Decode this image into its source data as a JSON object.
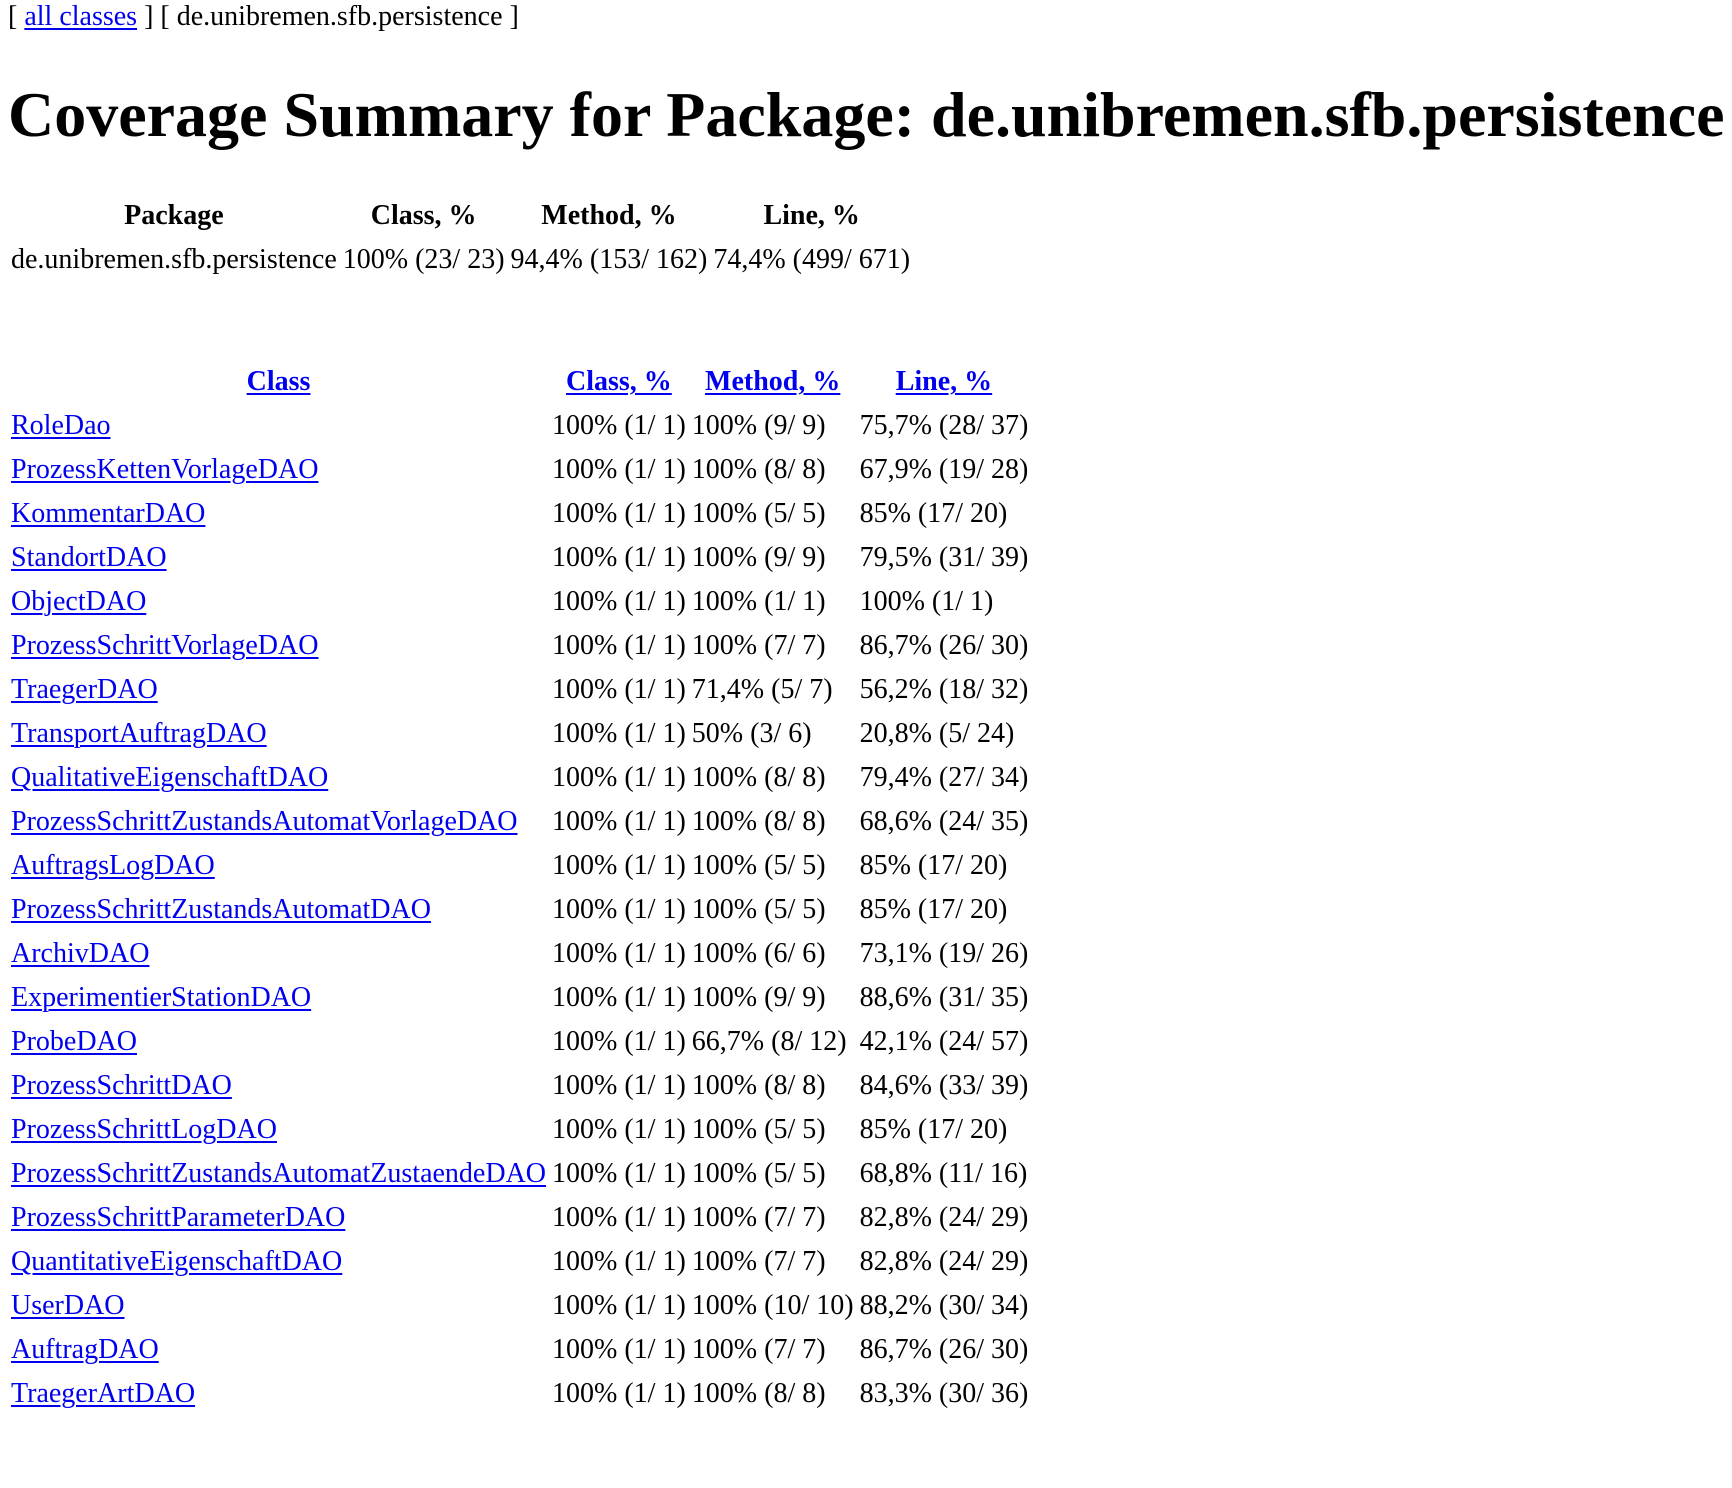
{
  "breadcrumb": {
    "open1": "[ ",
    "link": "all classes",
    "mid": " ] [ ",
    "current": "de.unibremen.sfb.persistence",
    "close": " ]"
  },
  "title": "Coverage Summary for Package: de.unibremen.sfb.persistence",
  "package_summary": {
    "headers": [
      "Package",
      "Class, %",
      "Method, %",
      "Line, %"
    ],
    "row": {
      "name": "de.unibremen.sfb.persistence",
      "class": "100% (23/ 23)",
      "method": "94,4% (153/ 162)",
      "line": "74,4% (499/ 671)"
    }
  },
  "class_table": {
    "headers": [
      "Class",
      "Class, %",
      "Method, %",
      "Line, %"
    ],
    "rows": [
      {
        "name": "RoleDao",
        "class": "100% (1/ 1)",
        "method": "100% (9/ 9)",
        "line": "75,7% (28/ 37)"
      },
      {
        "name": "ProzessKettenVorlageDAO",
        "class": "100% (1/ 1)",
        "method": "100% (8/ 8)",
        "line": "67,9% (19/ 28)"
      },
      {
        "name": "KommentarDAO",
        "class": "100% (1/ 1)",
        "method": "100% (5/ 5)",
        "line": "85% (17/ 20)"
      },
      {
        "name": "StandortDAO",
        "class": "100% (1/ 1)",
        "method": "100% (9/ 9)",
        "line": "79,5% (31/ 39)"
      },
      {
        "name": "ObjectDAO",
        "class": "100% (1/ 1)",
        "method": "100% (1/ 1)",
        "line": "100% (1/ 1)"
      },
      {
        "name": "ProzessSchrittVorlageDAO",
        "class": "100% (1/ 1)",
        "method": "100% (7/ 7)",
        "line": "86,7% (26/ 30)"
      },
      {
        "name": "TraegerDAO",
        "class": "100% (1/ 1)",
        "method": "71,4% (5/ 7)",
        "line": "56,2% (18/ 32)"
      },
      {
        "name": "TransportAuftragDAO",
        "class": "100% (1/ 1)",
        "method": "50% (3/ 6)",
        "line": "20,8% (5/ 24)"
      },
      {
        "name": "QualitativeEigenschaftDAO",
        "class": "100% (1/ 1)",
        "method": "100% (8/ 8)",
        "line": "79,4% (27/ 34)"
      },
      {
        "name": "ProzessSchrittZustandsAutomatVorlageDAO",
        "class": "100% (1/ 1)",
        "method": "100% (8/ 8)",
        "line": "68,6% (24/ 35)"
      },
      {
        "name": "AuftragsLogDAO",
        "class": "100% (1/ 1)",
        "method": "100% (5/ 5)",
        "line": "85% (17/ 20)"
      },
      {
        "name": "ProzessSchrittZustandsAutomatDAO",
        "class": "100% (1/ 1)",
        "method": "100% (5/ 5)",
        "line": "85% (17/ 20)"
      },
      {
        "name": "ArchivDAO",
        "class": "100% (1/ 1)",
        "method": "100% (6/ 6)",
        "line": "73,1% (19/ 26)"
      },
      {
        "name": "ExperimentierStationDAO",
        "class": "100% (1/ 1)",
        "method": "100% (9/ 9)",
        "line": "88,6% (31/ 35)"
      },
      {
        "name": "ProbeDAO",
        "class": "100% (1/ 1)",
        "method": "66,7% (8/ 12)",
        "line": "42,1% (24/ 57)"
      },
      {
        "name": "ProzessSchrittDAO",
        "class": "100% (1/ 1)",
        "method": "100% (8/ 8)",
        "line": "84,6% (33/ 39)"
      },
      {
        "name": "ProzessSchrittLogDAO",
        "class": "100% (1/ 1)",
        "method": "100% (5/ 5)",
        "line": "85% (17/ 20)"
      },
      {
        "name": "ProzessSchrittZustandsAutomatZustaendeDAO",
        "class": "100% (1/ 1)",
        "method": "100% (5/ 5)",
        "line": "68,8% (11/ 16)"
      },
      {
        "name": "ProzessSchrittParameterDAO",
        "class": "100% (1/ 1)",
        "method": "100% (7/ 7)",
        "line": "82,8% (24/ 29)"
      },
      {
        "name": "QuantitativeEigenschaftDAO",
        "class": "100% (1/ 1)",
        "method": "100% (7/ 7)",
        "line": "82,8% (24/ 29)"
      },
      {
        "name": "UserDAO",
        "class": "100% (1/ 1)",
        "method": "100% (10/ 10)",
        "line": "88,2% (30/ 34)"
      },
      {
        "name": "AuftragDAO",
        "class": "100% (1/ 1)",
        "method": "100% (7/ 7)",
        "line": "86,7% (26/ 30)"
      },
      {
        "name": "TraegerArtDAO",
        "class": "100% (1/ 1)",
        "method": "100% (8/ 8)",
        "line": "83,3% (30/ 36)"
      }
    ]
  },
  "colors": {
    "link": "#0000ee",
    "text": "#000000",
    "background": "#ffffff"
  }
}
